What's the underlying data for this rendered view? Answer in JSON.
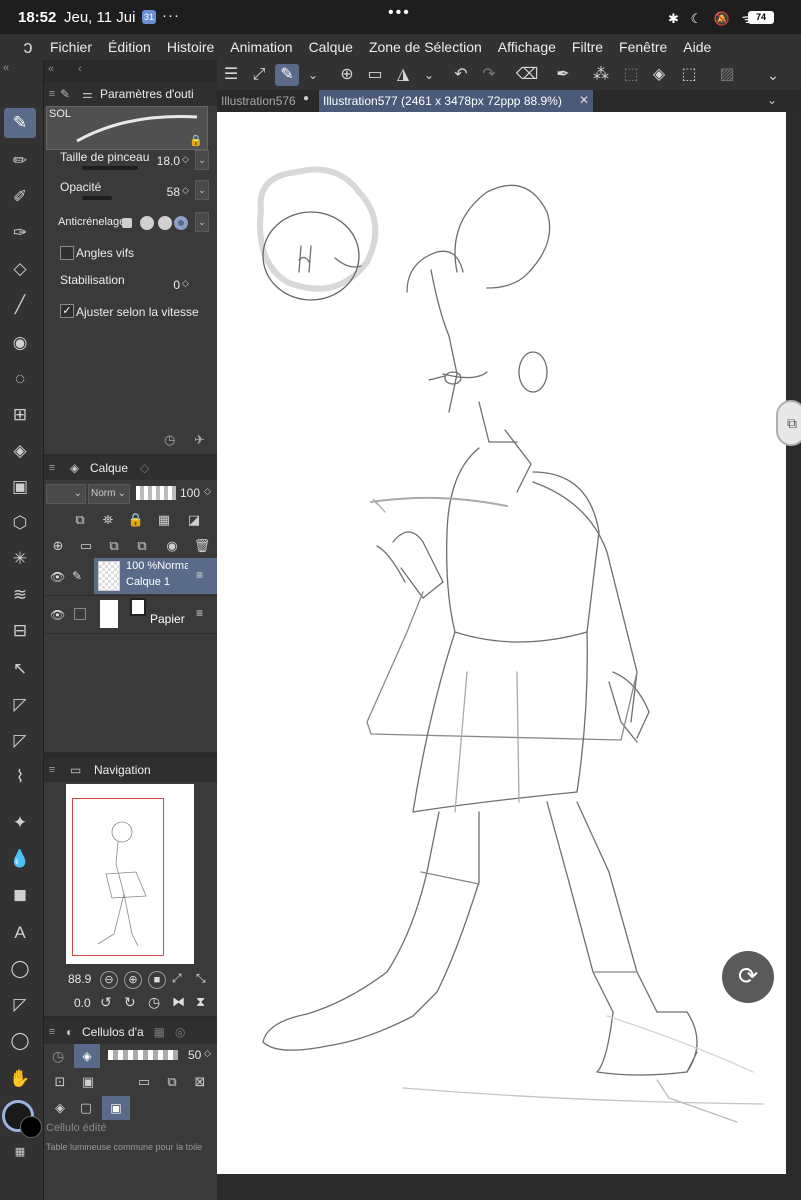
{
  "status_bar": {
    "time": "18:52",
    "date": "Jeu, 11 Jui",
    "badge": "31",
    "more": "···",
    "center_handle": "•••",
    "icons": "✱ ☾ 🔕 ᯤ",
    "battery": "74"
  },
  "menu": {
    "items": [
      "Fichier",
      "Édition",
      "Histoire",
      "Animation",
      "Calque",
      "Zone de Sélection",
      "Affichage",
      "Filtre",
      "Fenêtre",
      "Aide"
    ]
  },
  "tool_property": {
    "title": "Paramètres d'outi",
    "brush_name": "SOL",
    "brush_size_label": "Taille de pinceau",
    "brush_size_value": "18.0",
    "opacity_label": "Opacité",
    "opacity_value": "58",
    "antialias_label": "Anticrénelage",
    "sharp_angles_label": "Angles vifs",
    "sharp_angles_checked": false,
    "stabilization_label": "Stabilisation",
    "stabilization_value": "0",
    "speed_adjust_label": "Ajuster selon la vitesse",
    "speed_adjust_checked": true
  },
  "layer_panel": {
    "title": "Calque",
    "blend_mode": "Norm",
    "opacity": "100",
    "layers": [
      {
        "opacity_mode": "100 %Norma",
        "name": "Calque 1",
        "selected": true
      },
      {
        "opacity_mode": "",
        "name": "Papier",
        "selected": false
      }
    ]
  },
  "navigation": {
    "title": "Navigation",
    "zoom": "88.9",
    "rotation": "0.0"
  },
  "cel_panel": {
    "title": "Cellulos d'a",
    "opacity": "50",
    "edited_cel": "Cellulo édité",
    "lightbox_label": "Table lumineuse commune pour la toile"
  },
  "tabs": [
    {
      "label": "Illustration576",
      "active": false
    },
    {
      "label": "Illustration577 (2461 x 3478px 72ppp 88.9%)",
      "active": true
    }
  ],
  "colors": {
    "accent": "#5a6b8a",
    "panel": "#3a3a3a",
    "canvas": "#ffffff"
  }
}
